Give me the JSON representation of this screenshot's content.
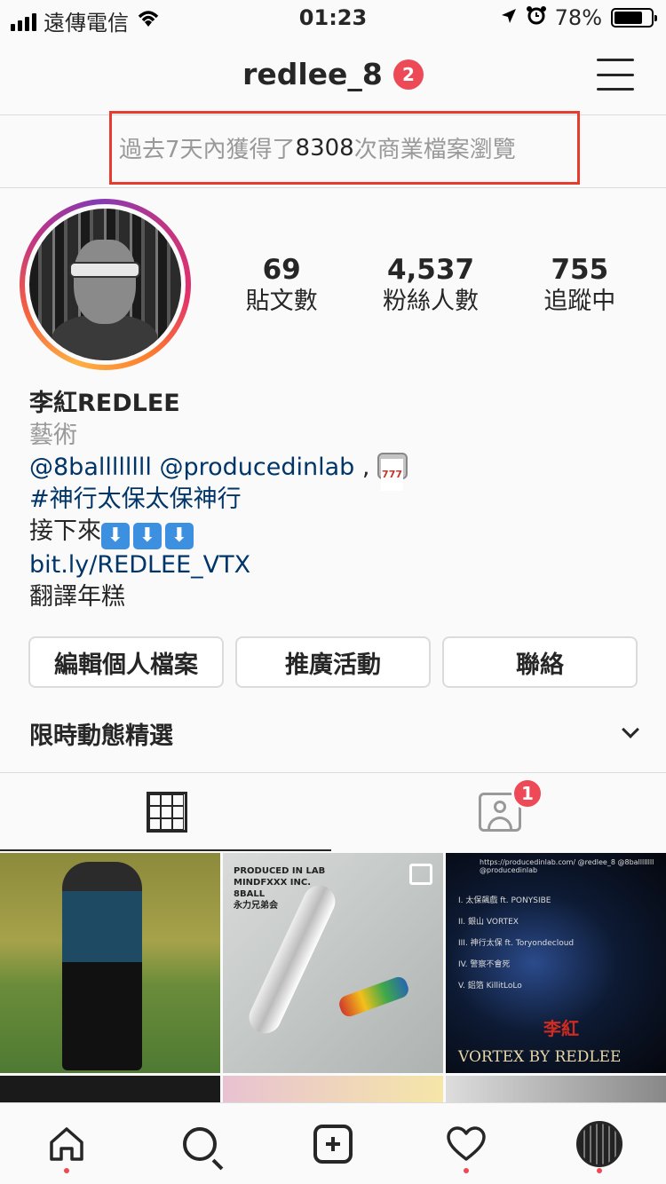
{
  "status_bar": {
    "carrier": "遠傳電信",
    "time": "01:23",
    "battery": "78%",
    "battery_level": 0.78
  },
  "header": {
    "username": "redlee_8",
    "notification_count": "2"
  },
  "insights": {
    "prefix": "過去7天內獲得了",
    "count": "8308",
    "suffix": "次商業檔案瀏覽"
  },
  "stats": [
    {
      "value": "69",
      "label": "貼文數"
    },
    {
      "value": "4,537",
      "label": "粉絲人數"
    },
    {
      "value": "755",
      "label": "追蹤中"
    }
  ],
  "bio": {
    "name": "李紅REDLEE",
    "category": "藝術",
    "mentions": "@8ballllllll @producedinlab",
    "mentions_after": " ,",
    "hashtag": "#神行太保太保神行",
    "next_text": "接下來",
    "arrows": [
      "⬇",
      "⬇",
      "⬇"
    ],
    "link": "bit.ly/REDLEE_VTX",
    "last_line": "翻譯年糕"
  },
  "buttons": {
    "edit_profile": "編輯個人檔案",
    "promotions": "推廣活動",
    "contact": "聯絡"
  },
  "highlights": {
    "label": "限時動態精選"
  },
  "tabs": {
    "tagged_badge": "1"
  },
  "posts": {
    "post2_text": "PRODUCED IN LAB\nMINDFXXX INC.\n8BALL\n永力兄弟会",
    "post3_url": "https://producedinlab.com/ @redlee_8 @8ballllllll @producedinlab",
    "post3_tracks": [
      "I. 太保飆戲 ft. PONYSIBE",
      "II. 銀山 VORTEX",
      "III. 神行太保 ft. Toryondecloud",
      "IV. 警察不會死",
      "V. 鋁箔 KillitLoLo"
    ],
    "post3_title_cn": "李紅",
    "post3_title_en": "VORTEX BY    REDLEE"
  }
}
